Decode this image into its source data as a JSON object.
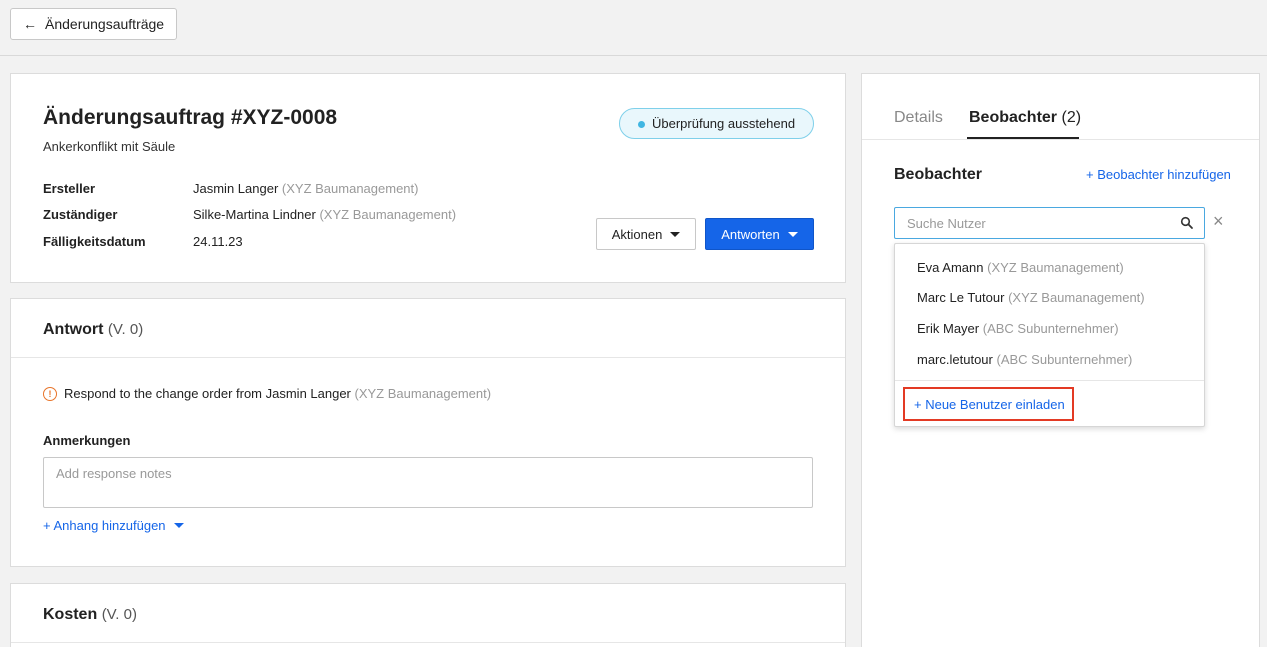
{
  "topbar": {
    "back_label": "Änderungsaufträge"
  },
  "order": {
    "title": "Änderungsauftrag #XYZ-0008",
    "subtitle": "Ankerkonflikt mit Säule",
    "status": "Überprüfung ausstehend",
    "fields": [
      {
        "label": "Ersteller",
        "name": "Jasmin Langer",
        "org": "(XYZ Baumanagement)"
      },
      {
        "label": "Zuständiger",
        "name": "Silke-Martina Lindner",
        "org": "(XYZ Baumanagement)"
      },
      {
        "label": "Fälligkeitsdatum",
        "name": "24.11.23",
        "org": ""
      }
    ],
    "actions_label": "Aktionen",
    "reply_label": "Antworten"
  },
  "response": {
    "title": "Antwort",
    "version": "(V. 0)",
    "warning_text": "Respond to the change order from Jasmin Langer",
    "warning_org": "(XYZ Baumanagement)",
    "notes_label": "Anmerkungen",
    "notes_placeholder": "Add response notes",
    "attach_label": "+ Anhang hinzufügen"
  },
  "costs": {
    "title": "Kosten",
    "version": "(V. 0)"
  },
  "sidebar": {
    "tab_details": "Details",
    "tab_observers": "Beobachter",
    "tab_observers_count": "(2)",
    "observers_title": "Beobachter",
    "add_observer": "+ Beobachter hinzufügen",
    "search_placeholder": "Suche Nutzer",
    "users": [
      {
        "name": "Eva Amann",
        "org": "(XYZ Baumanagement)"
      },
      {
        "name": "Marc Le Tutour",
        "org": "(XYZ Baumanagement)"
      },
      {
        "name": "Erik Mayer",
        "org": "(ABC Subunternehmer)"
      },
      {
        "name": "marc.letutour",
        "org": "(ABC Subunternehmer)"
      }
    ],
    "invite_label": "+ Neue Benutzer einladen"
  },
  "colors": {
    "primary": "#1565e8",
    "status_border": "#7fd0ea",
    "highlight": "#e33a24"
  }
}
